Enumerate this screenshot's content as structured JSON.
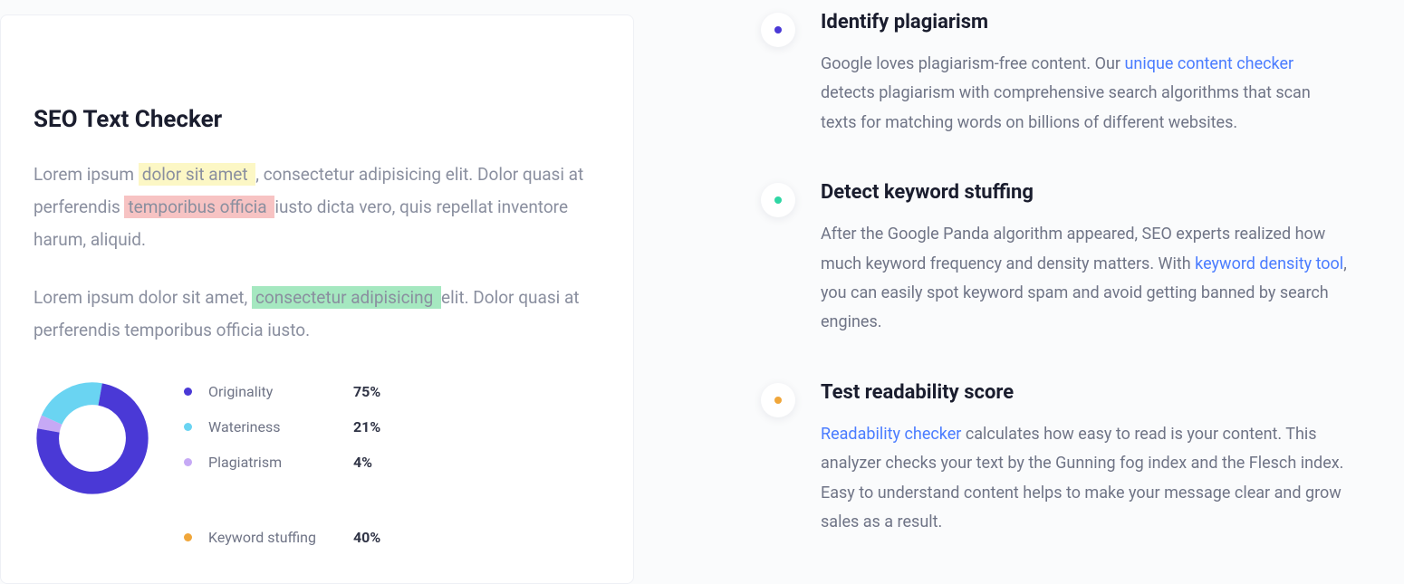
{
  "colors": {
    "purple": "#4a39d6",
    "cyan": "#6ad4f2",
    "lilac": "#c6a9f5",
    "orange": "#f0a63a",
    "green": "#2fd6a4"
  },
  "left": {
    "title": "SEO Text Checker",
    "para1": {
      "t1": "Lorem ipsum ",
      "hl1": "dolor sit amet ",
      "t2": ", consectetur adipisicing elit. Dolor quasi at perferendis ",
      "hl2": "temporibus officia ",
      "t3": " iusto dicta vero, quis repellat inventore harum, aliquid."
    },
    "para2": {
      "t1": "Lorem ipsum dolor sit amet, ",
      "hl1": "consectetur adipisicing ",
      "t2": " elit. Dolor quasi at perferendis temporibus officia iusto."
    },
    "legend": [
      {
        "label": "Originality",
        "value": "75%"
      },
      {
        "label": "Wateriness",
        "value": "21%"
      },
      {
        "label": "Plagiatrism",
        "value": "4%"
      },
      {
        "label": "Keyword stuffing",
        "value": "40%"
      }
    ]
  },
  "chart_data": {
    "type": "pie",
    "title": "",
    "categories": [
      "Originality",
      "Wateriness",
      "Plagiatrism"
    ],
    "values": [
      75,
      21,
      4
    ],
    "colors": [
      "#4a39d6",
      "#6ad4f2",
      "#c6a9f5"
    ]
  },
  "right": {
    "features": [
      {
        "title": "Identify plagiarism",
        "desc_pre": "Google loves plagiarism-free content. Our ",
        "link": "unique content checker",
        "desc_post": " detects plagiarism with comprehensive search algorithms that scan texts for matching words on billions of different websites."
      },
      {
        "title": "Detect keyword stuffing",
        "desc_pre": "After the Google Panda algorithm appeared, SEO experts realized how much keyword frequency and density matters. With ",
        "link": "keyword density tool",
        "desc_post": ", you can easily spot keyword spam and avoid getting banned by search engines."
      },
      {
        "title": "Test readability score",
        "desc_pre": "",
        "link": "Readability checker",
        "desc_post": " calculates how easy to read is your content. This analyzer checks your text by the Gunning fog index and the Flesch index. Easy to understand content helps to make your message clear and grow sales as a result."
      }
    ]
  }
}
